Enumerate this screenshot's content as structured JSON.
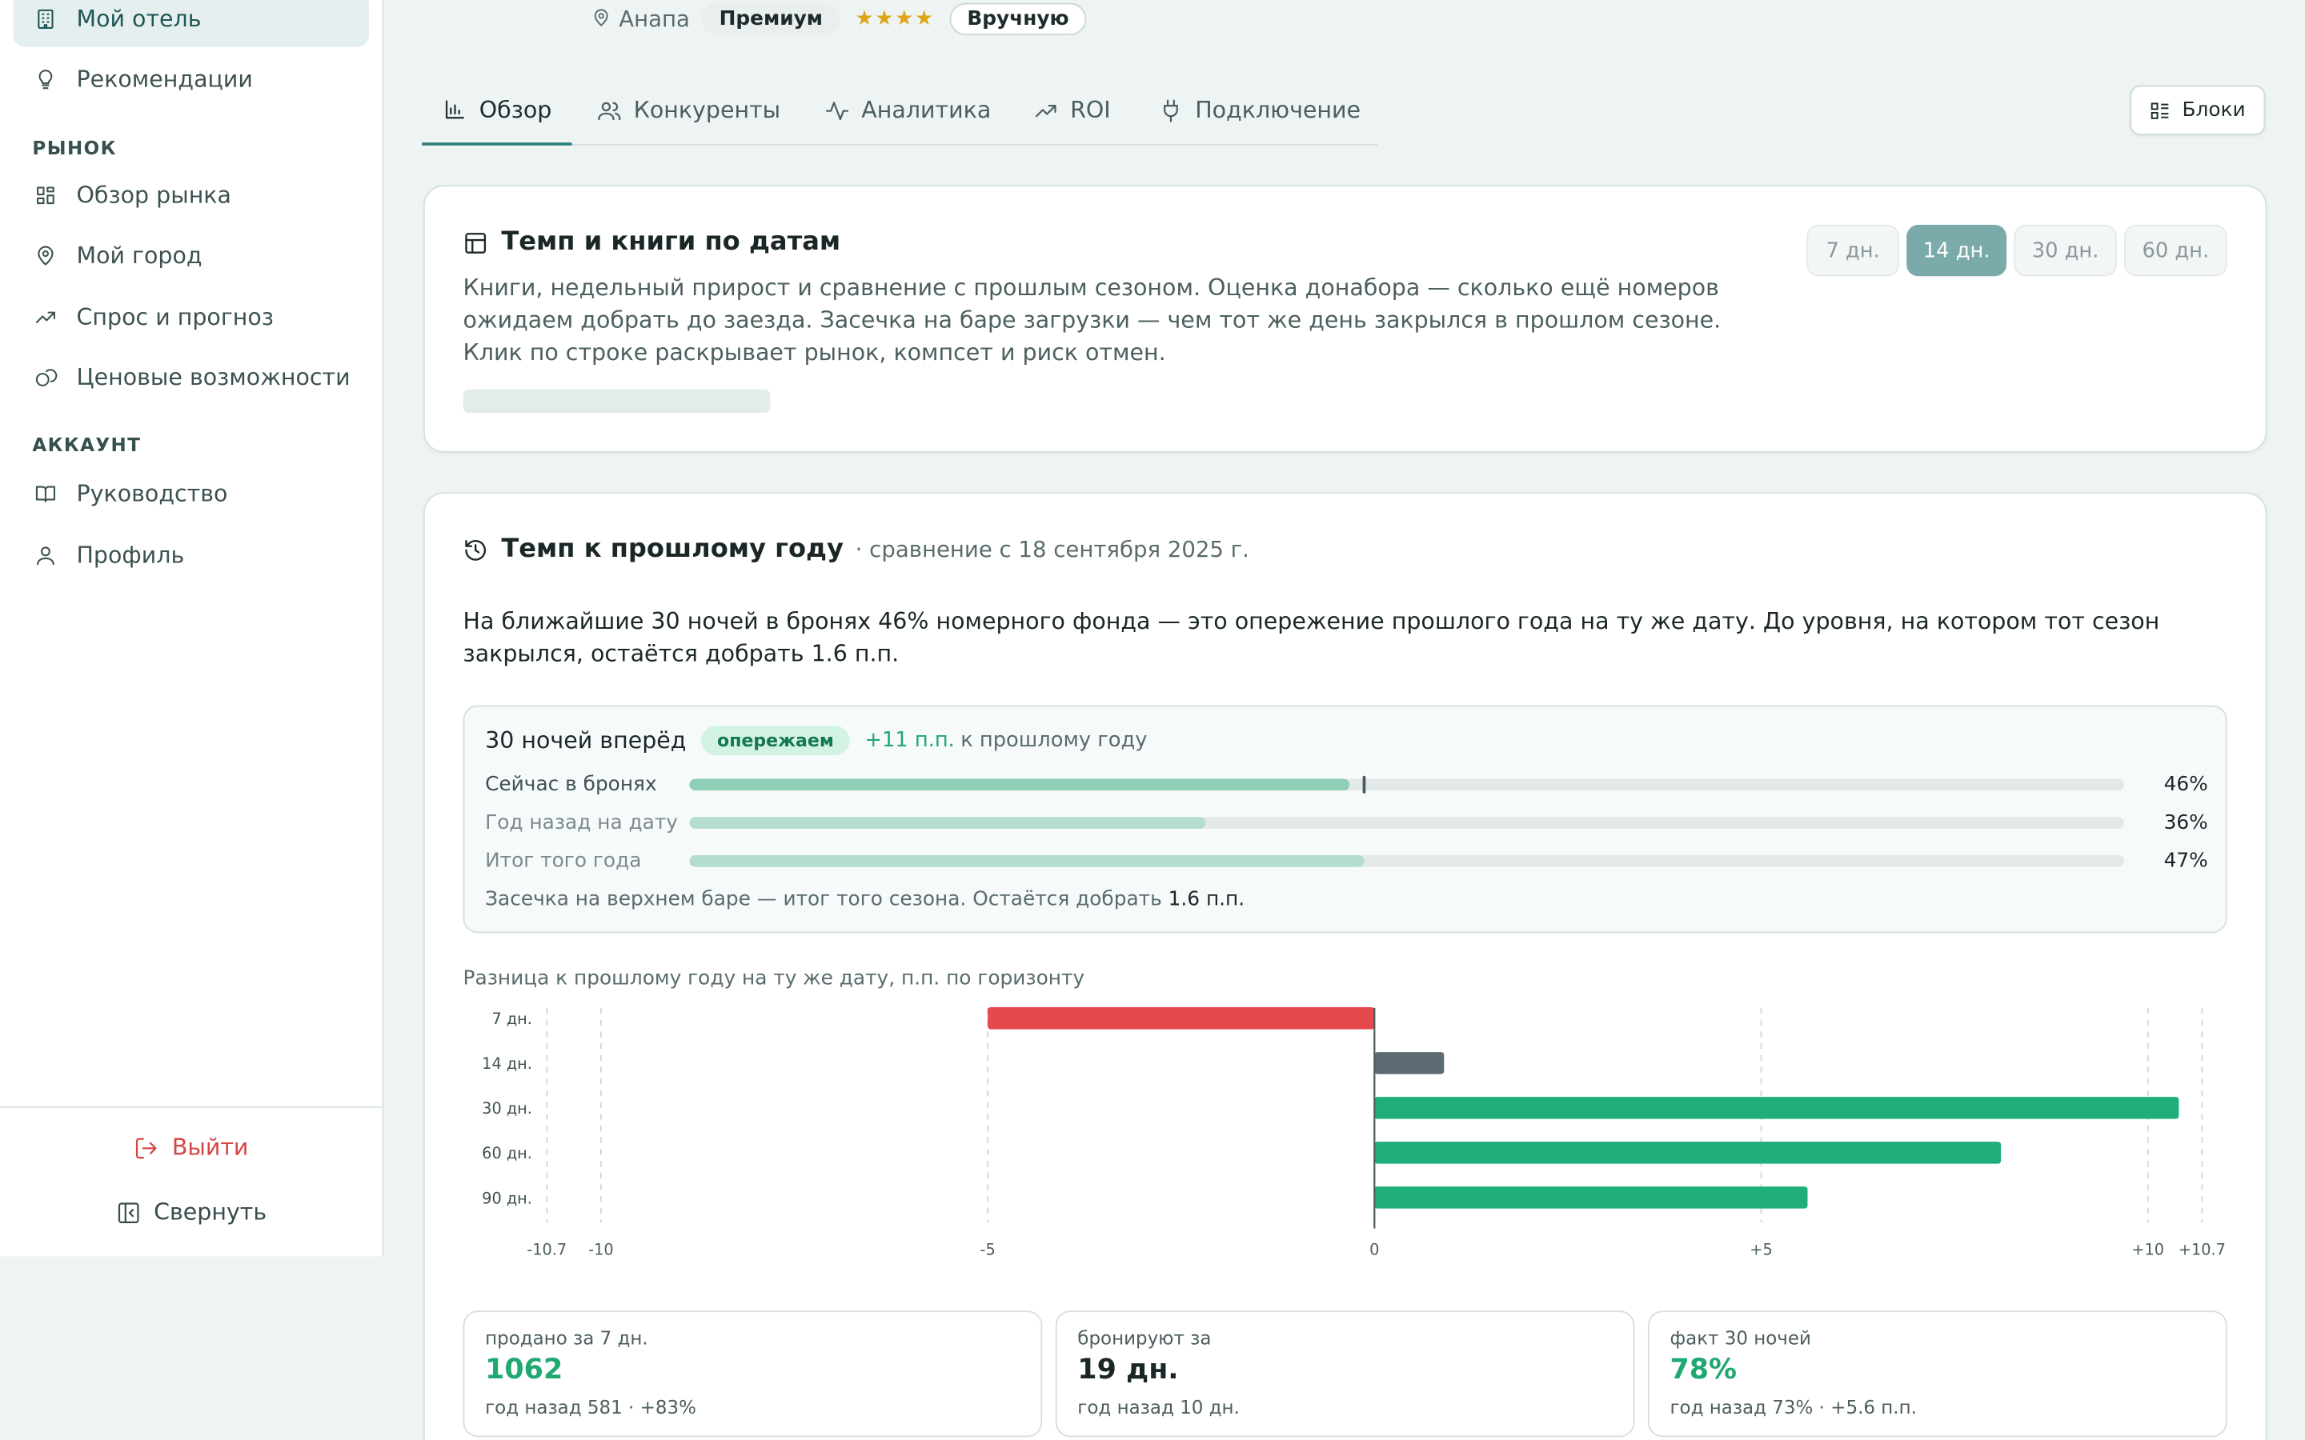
{
  "sidebar": {
    "items": [
      {
        "label": "Мой отель",
        "icon": "building-icon"
      },
      {
        "label": "Рекомендации",
        "icon": "lightbulb-icon"
      },
      {
        "label": "Обзор рынка",
        "icon": "dashboard-icon"
      },
      {
        "label": "Мой город",
        "icon": "map-pin-icon"
      },
      {
        "label": "Спрос и прогноз",
        "icon": "trending-up-icon"
      },
      {
        "label": "Ценовые возможности",
        "icon": "coins-icon"
      },
      {
        "label": "Руководство",
        "icon": "book-icon"
      },
      {
        "label": "Профиль",
        "icon": "user-icon"
      }
    ],
    "sections": {
      "market": "РЫНОК",
      "account": "АККАУНТ"
    },
    "logout_label": "Выйти",
    "collapse_label": "Свернуть"
  },
  "header": {
    "city": "Анапа",
    "tier": "Премиум",
    "stars": "★★★★",
    "mode": "Вручную"
  },
  "tabs": [
    {
      "label": "Обзор",
      "icon": "bar-chart-icon",
      "active": true
    },
    {
      "label": "Конкуренты",
      "icon": "users-icon"
    },
    {
      "label": "Аналитика",
      "icon": "activity-icon"
    },
    {
      "label": "ROI",
      "icon": "trending-up-icon"
    },
    {
      "label": "Подключение",
      "icon": "plug-icon"
    }
  ],
  "blocks_button": "Блоки",
  "pace_books": {
    "title": "Темп и книги по датам",
    "description": "Книги, недельный прирост и сравнение с прошлым сезоном. Оценка донабора — сколько ещё номеров ожидаем добрать до заезда. Засечка на баре загрузки — чем тот же день закрылся в прошлом сезоне. Клик по строке раскрывает рынок, компсет и риск отмен.",
    "ranges": [
      "7 дн.",
      "14 дн.",
      "30 дн.",
      "60 дн."
    ],
    "active_range": "14 дн."
  },
  "pace_yoy": {
    "title": "Темп к прошлому году",
    "subtitle": "· сравнение с 18 сентября 2025 г.",
    "summary": "На ближайшие 30 ночей в бронях 46% номерного фонда — это опережение прошлого года на ту же дату. До уровня, на котором тот сезон закрылся, остаётся добрать 1.6 п.п.",
    "panel": {
      "title": "30 ночей вперёд",
      "status": "опережаем",
      "delta": "+11 п.п.",
      "delta_suffix": "к прошлому году",
      "bars": [
        {
          "label": "Сейчас в бронях",
          "value": 46,
          "value_text": "46%",
          "color": "#8fcfb5"
        },
        {
          "label": "Год назад на дату",
          "value": 36,
          "value_text": "36%",
          "color": "#b3ddd0"
        },
        {
          "label": "Итог того года",
          "value": 47,
          "value_text": "47%",
          "color": "#b3ddd0"
        }
      ],
      "marker_value": 47,
      "note_prefix": "Засечка на верхнем баре — итог того сезона. Остаётся добрать",
      "note_value": "1.6 п.п."
    },
    "chart_caption": "Разница к прошлому году на ту же дату, п.п. по горизонту",
    "kpis": [
      {
        "label": "продано за 7 дн.",
        "value": "1062",
        "sub": "год назад 581 · +83%",
        "color": "#1fa870"
      },
      {
        "label": "бронируют за",
        "value": "19 дн.",
        "sub": "год назад 10 дн.",
        "color": "#1b2727"
      },
      {
        "label": "факт 30 ночей",
        "value": "78%",
        "sub": "год назад 73% · +5.6 п.п.",
        "color": "#1fa870"
      }
    ]
  },
  "chart_data": {
    "type": "bar",
    "orientation": "horizontal",
    "categories": [
      "7 дн.",
      "14 дн.",
      "30 дн.",
      "60 дн.",
      "90 дн."
    ],
    "values": [
      -5.0,
      0.9,
      10.4,
      8.1,
      5.6
    ],
    "colors": [
      "#e5484d",
      "#5d6b72",
      "#1fae7a",
      "#1fae7a",
      "#1fae7a"
    ],
    "xlim": [
      -10.7,
      10.7
    ],
    "xticks": [
      {
        "value": -10.7,
        "label": "-10.7"
      },
      {
        "value": -10,
        "label": "-10"
      },
      {
        "value": -5,
        "label": "-5"
      },
      {
        "value": 0,
        "label": "0"
      },
      {
        "value": 5,
        "label": "+5"
      },
      {
        "value": 10,
        "label": "+10"
      },
      {
        "value": 10.7,
        "label": "+10.7"
      }
    ],
    "grid": true
  }
}
